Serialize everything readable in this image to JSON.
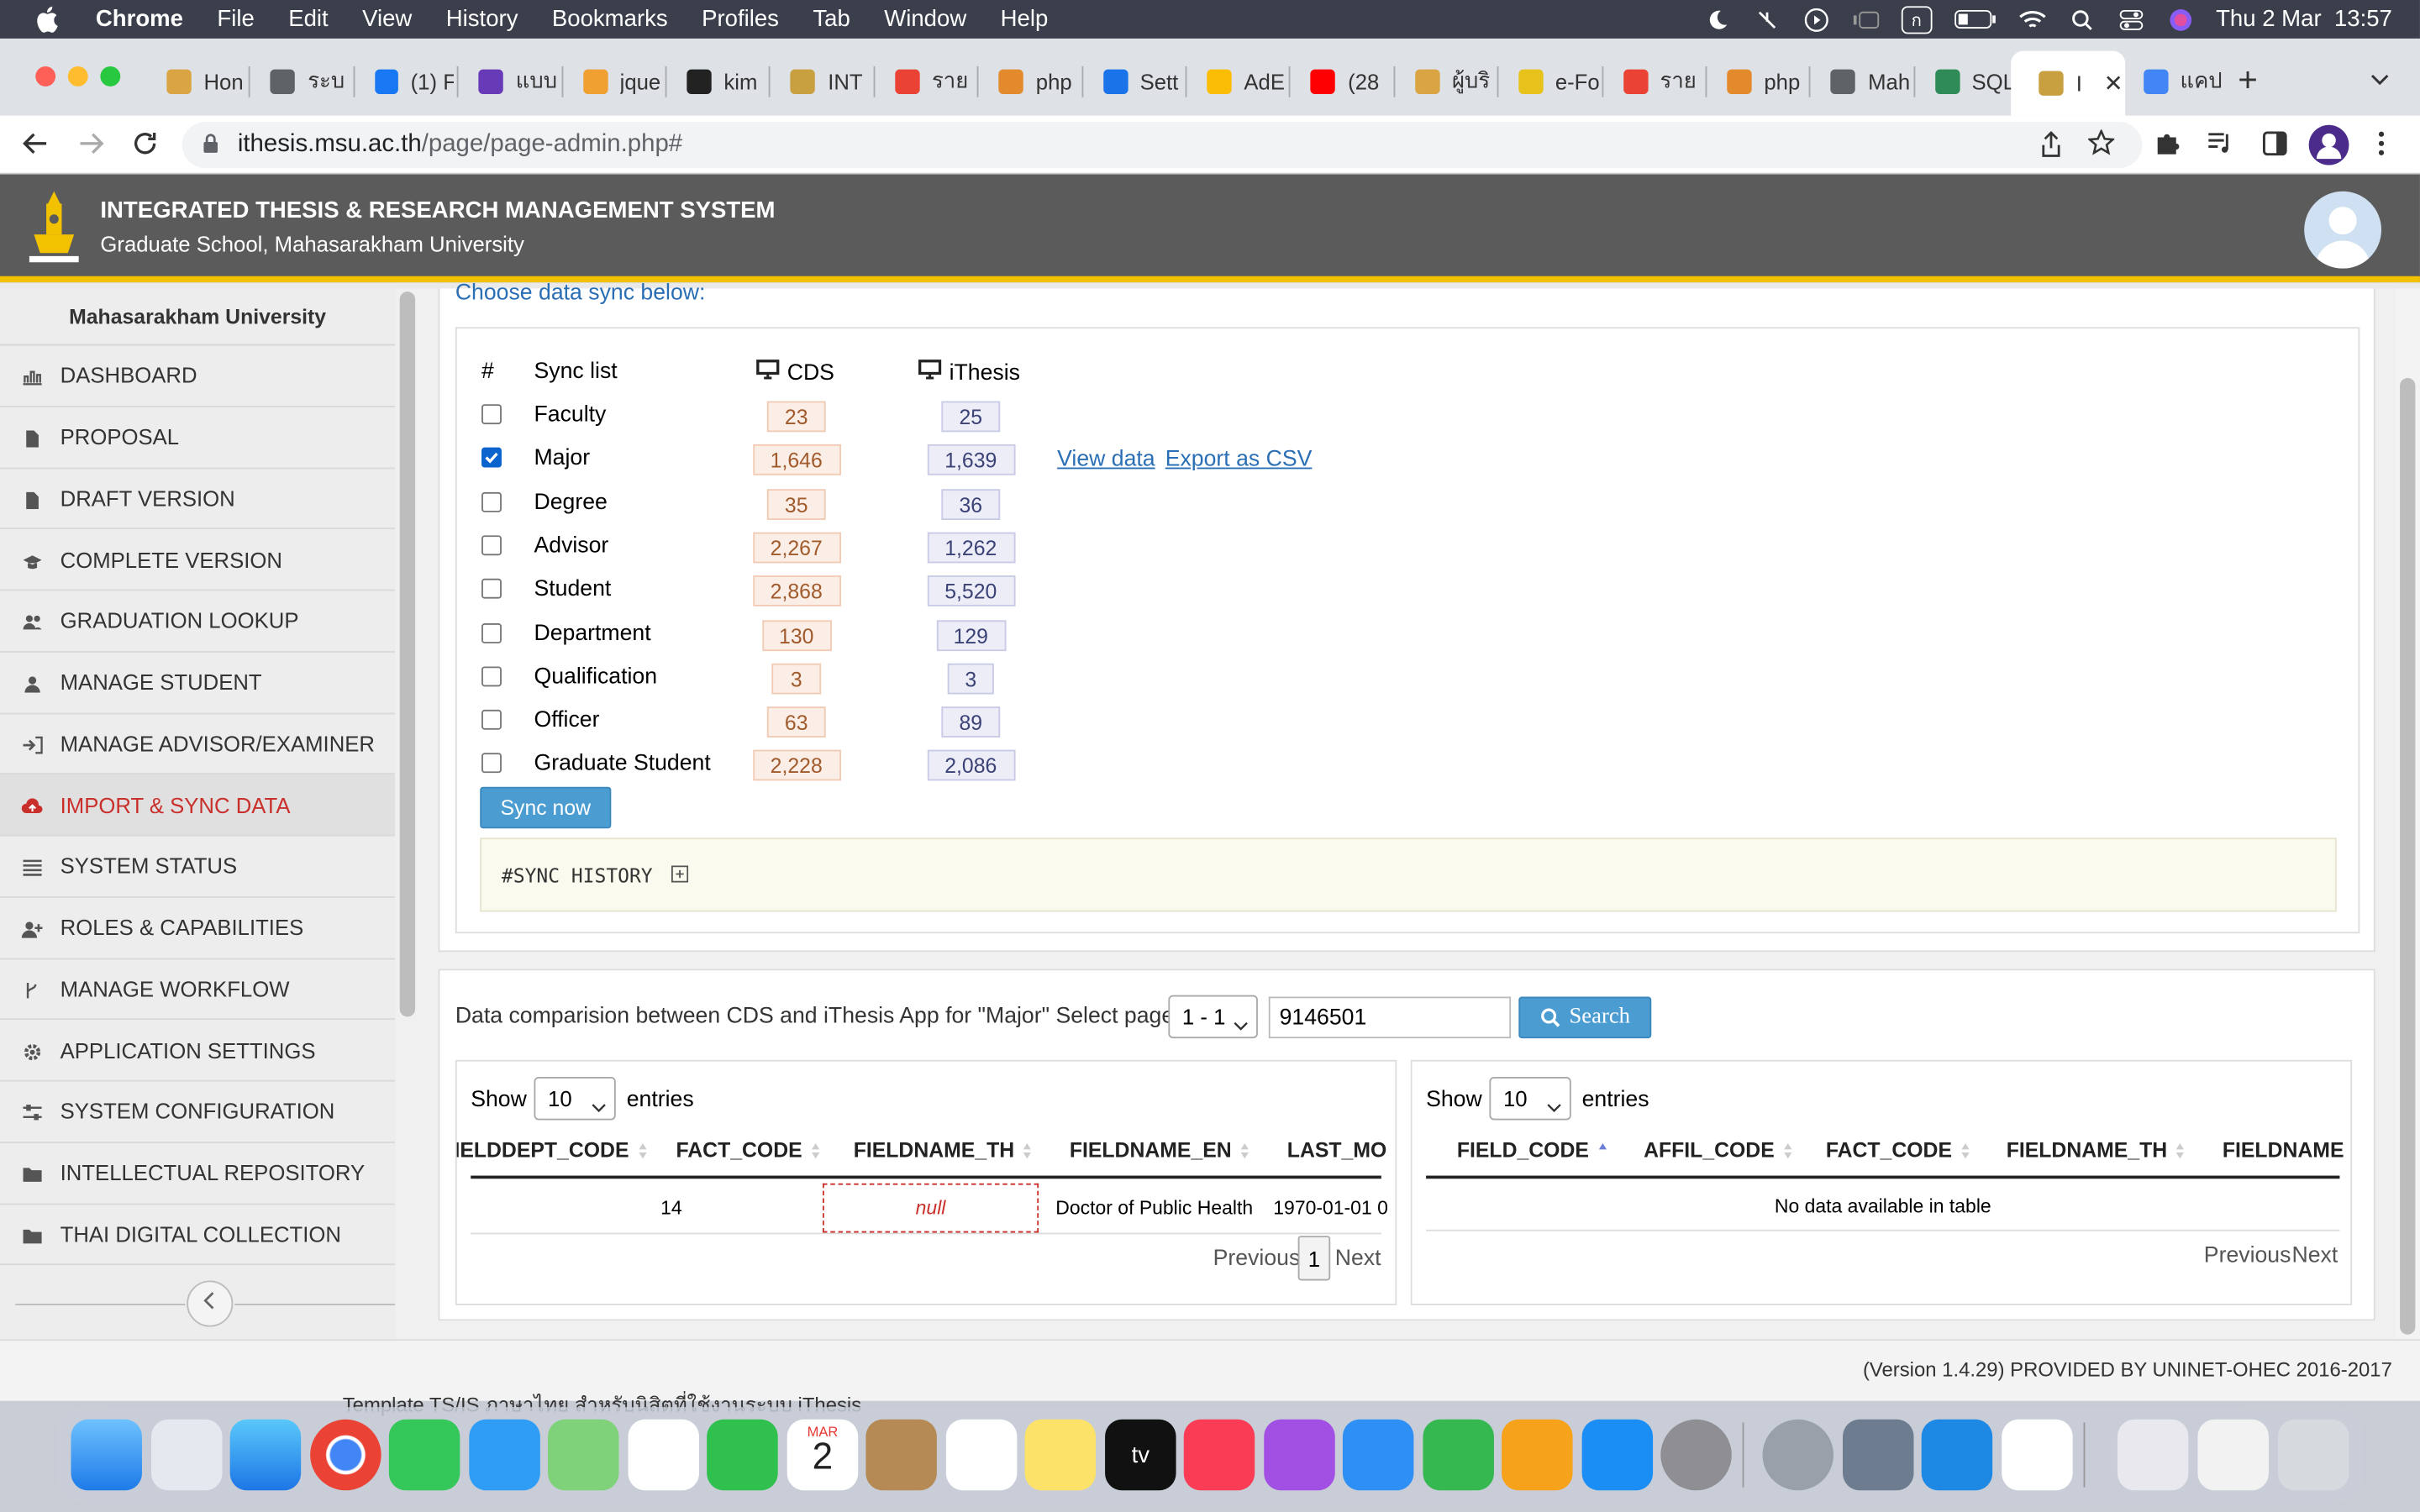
{
  "menubar": {
    "app": "Chrome",
    "items": [
      "File",
      "Edit",
      "View",
      "History",
      "Bookmarks",
      "Profiles",
      "Tab",
      "Window",
      "Help"
    ],
    "clock": "Thu 2 Mar  13:57",
    "input_source": "ก"
  },
  "tabs": [
    {
      "label": "Hon",
      "color": "#d9a441"
    },
    {
      "label": "ระบ",
      "color": "#5f6368"
    },
    {
      "label": "(1) F",
      "color": "#1877f2"
    },
    {
      "label": "แบบ",
      "color": "#673ab7"
    },
    {
      "label": "jque",
      "color": "#f0a030"
    },
    {
      "label": "kim",
      "color": "#222"
    },
    {
      "label": "INT",
      "color": "#c8a040"
    },
    {
      "label": "ราย",
      "color": "#ea4335"
    },
    {
      "label": "php",
      "color": "#e38b2c"
    },
    {
      "label": "Sett",
      "color": "#1a73e8"
    },
    {
      "label": "AdE",
      "color": "#fbbc04"
    },
    {
      "label": "(28",
      "color": "#ff0000"
    },
    {
      "label": "ผู้บริ",
      "color": "#d9a441"
    },
    {
      "label": "e-Fo",
      "color": "#e6c21a"
    },
    {
      "label": "ราย",
      "color": "#ea4335"
    },
    {
      "label": "php",
      "color": "#e38b2c"
    },
    {
      "label": "Mah",
      "color": "#5f6368"
    },
    {
      "label": "SQL",
      "color": "#2e8b57"
    },
    {
      "label": "I",
      "color": "#c8a040"
    },
    {
      "label": "แคป",
      "color": "#4285f4"
    }
  ],
  "address": {
    "domain": "ithesis.msu.ac.th",
    "path": "/page/page-admin.php#"
  },
  "header": {
    "title": "INTEGRATED THESIS & RESEARCH MANAGEMENT SYSTEM",
    "subtitle": "Graduate School, Mahasarakham University"
  },
  "sidebar": {
    "title": "Mahasarakham University",
    "items": [
      {
        "label": "DASHBOARD",
        "icon": "chart-icon"
      },
      {
        "label": "PROPOSAL",
        "icon": "file-icon"
      },
      {
        "label": "DRAFT VERSION",
        "icon": "file-icon"
      },
      {
        "label": "COMPLETE VERSION",
        "icon": "graduation-cap-icon"
      },
      {
        "label": "GRADUATION LOOKUP",
        "icon": "users-icon"
      },
      {
        "label": "MANAGE STUDENT",
        "icon": "user-icon"
      },
      {
        "label": "MANAGE ADVISOR/EXAMINER",
        "icon": "sign-in-icon"
      },
      {
        "label": "IMPORT & SYNC DATA",
        "icon": "cloud-upload-icon"
      },
      {
        "label": "SYSTEM STATUS",
        "icon": "list-icon"
      },
      {
        "label": "ROLES & CAPABILITIES",
        "icon": "user-plus-icon"
      },
      {
        "label": "MANAGE WORKFLOW",
        "icon": "branch-icon"
      },
      {
        "label": "APPLICATION SETTINGS",
        "icon": "gear-icon"
      },
      {
        "label": "SYSTEM CONFIGURATION",
        "icon": "sliders-icon"
      },
      {
        "label": "INTELLECTUAL REPOSITORY",
        "icon": "folder-icon"
      },
      {
        "label": "THAI DIGITAL COLLECTION",
        "icon": "folder-icon"
      }
    ]
  },
  "sync": {
    "intro": "Choose data sync below:",
    "col_hash": "#",
    "col_list": "Sync list",
    "col_cds": "CDS",
    "col_ithesis": "iThesis",
    "rows": [
      {
        "name": "Faculty",
        "cds": "23",
        "ithesis": "25",
        "checked": false
      },
      {
        "name": "Major",
        "cds": "1,646",
        "ithesis": "1,639",
        "checked": true
      },
      {
        "name": "Degree",
        "cds": "35",
        "ithesis": "36",
        "checked": false
      },
      {
        "name": "Advisor",
        "cds": "2,267",
        "ithesis": "1,262",
        "checked": false
      },
      {
        "name": "Student",
        "cds": "2,868",
        "ithesis": "5,520",
        "checked": false
      },
      {
        "name": "Department",
        "cds": "130",
        "ithesis": "129",
        "checked": false
      },
      {
        "name": "Qualification",
        "cds": "3",
        "ithesis": "3",
        "checked": false
      },
      {
        "name": "Officer",
        "cds": "63",
        "ithesis": "89",
        "checked": false
      },
      {
        "name": "Graduate Student",
        "cds": "2,228",
        "ithesis": "2,086",
        "checked": false
      }
    ],
    "view_data": "View data",
    "export_csv": "Export as CSV",
    "sync_button": "Sync now",
    "history_label": "#SYNC HISTORY"
  },
  "comparison": {
    "label": "Data comparision between CDS and iThesis App for \"Major\" Select page:",
    "page_select": "1 - 1",
    "search_value": "9146501",
    "search_button": "Search",
    "left": {
      "show": "Show",
      "entries_value": "10",
      "entries": "entries",
      "columns": [
        "FIELDDEPT_CODE",
        "FACT_CODE",
        "FIELDNAME_TH",
        "FIELDNAME_EN",
        "LAST_MO"
      ],
      "row": {
        "fact_code": "14",
        "fieldname_th": "null",
        "fieldname_en": "Doctor of Public Health",
        "last_mod": "1970-01-01 0"
      },
      "prev": "Previous",
      "page": "1",
      "next": "Next"
    },
    "right": {
      "show": "Show",
      "entries_value": "10",
      "entries": "entries",
      "columns": [
        "FIELD_CODE",
        "AFFIL_CODE",
        "FACT_CODE",
        "FIELDNAME_TH",
        "FIELDNAME"
      ],
      "empty": "No data available in table",
      "prev": "Previous",
      "next": "Next"
    }
  },
  "footer": {
    "version": "(Version 1.4.29) PROVIDED BY UNINET-OHEC 2016-2017"
  },
  "behind_text": "Template TS/IS ภาษาไทย สำหรับนิสิตที่ใช้งานระบบ iThesis",
  "dock": {
    "calendar_month": "MAR",
    "calendar_day": "2",
    "tv_label": "tv"
  },
  "colors": {
    "accent": "#4a9cd1",
    "active_menu": "#c9302c",
    "header_bar": "#5b5b5b",
    "header_stripe": "#f2c200"
  }
}
